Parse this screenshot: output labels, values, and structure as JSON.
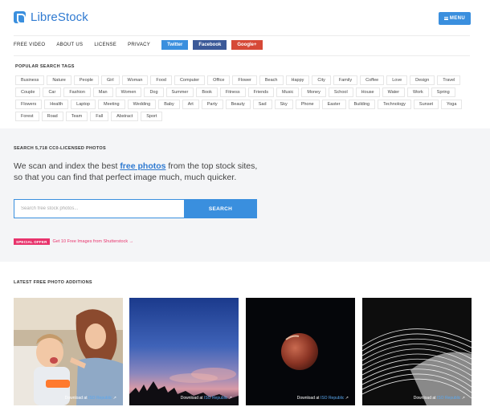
{
  "brand": {
    "name": "LibreStock"
  },
  "header": {
    "menu_label": "MENU"
  },
  "topnav": {
    "links": [
      "FREE VIDEO",
      "ABOUT US",
      "LICENSE",
      "PRIVACY"
    ],
    "social": [
      "Twitter",
      "Facebook",
      "Google+"
    ]
  },
  "tags": {
    "title": "POPULAR SEARCH TAGS",
    "items": [
      "Business",
      "Nature",
      "People",
      "Girl",
      "Woman",
      "Food",
      "Computer",
      "Office",
      "Flower",
      "Beach",
      "Happy",
      "City",
      "Family",
      "Coffee",
      "Love",
      "Design",
      "Travel",
      "Couple",
      "Car",
      "Fashion",
      "Man",
      "Women",
      "Dog",
      "Summer",
      "Book",
      "Fitness",
      "Friends",
      "Music",
      "Money",
      "School",
      "House",
      "Water",
      "Work",
      "Spring",
      "Flowers",
      "Health",
      "Laptop",
      "Meeting",
      "Wedding",
      "Baby",
      "Art",
      "Party",
      "Beauty",
      "Sad",
      "Sky",
      "Phone",
      "Easter",
      "Building",
      "Technology",
      "Sunset",
      "Yoga",
      "Forest",
      "Road",
      "Team",
      "Fall",
      "Abstract",
      "Sport"
    ]
  },
  "search": {
    "eyebrow": "SEARCH 5,718 CC0-LICENSED PHOTOS",
    "lead_before": "We scan and index the best ",
    "lead_highlight": "free photos",
    "lead_after": " from the top stock sites, so that you can find that perfect image much, much quicker.",
    "placeholder": "Search free stock photos...",
    "button": "SEARCH",
    "offer_badge": "SPECIAL OFFER",
    "offer_text": "Get 10 Free Images from Shutterstock →"
  },
  "latest": {
    "title": "LATEST FREE PHOTO ADDITIONS",
    "photos": [
      {
        "credit_prefix": "Download at ",
        "source": "ISO Republic"
      },
      {
        "credit_prefix": "Download at ",
        "source": "ISO Republic"
      },
      {
        "credit_prefix": "Download at ",
        "source": "ISO Republic"
      },
      {
        "credit_prefix": "Download at ",
        "source": "ISO Republic"
      }
    ]
  },
  "colors": {
    "accent": "#3a8fde",
    "brand_text": "#2f7ad1",
    "offer": "#e8336c",
    "twitter": "#3a8fde",
    "facebook": "#3b5998",
    "google": "#d64937"
  }
}
